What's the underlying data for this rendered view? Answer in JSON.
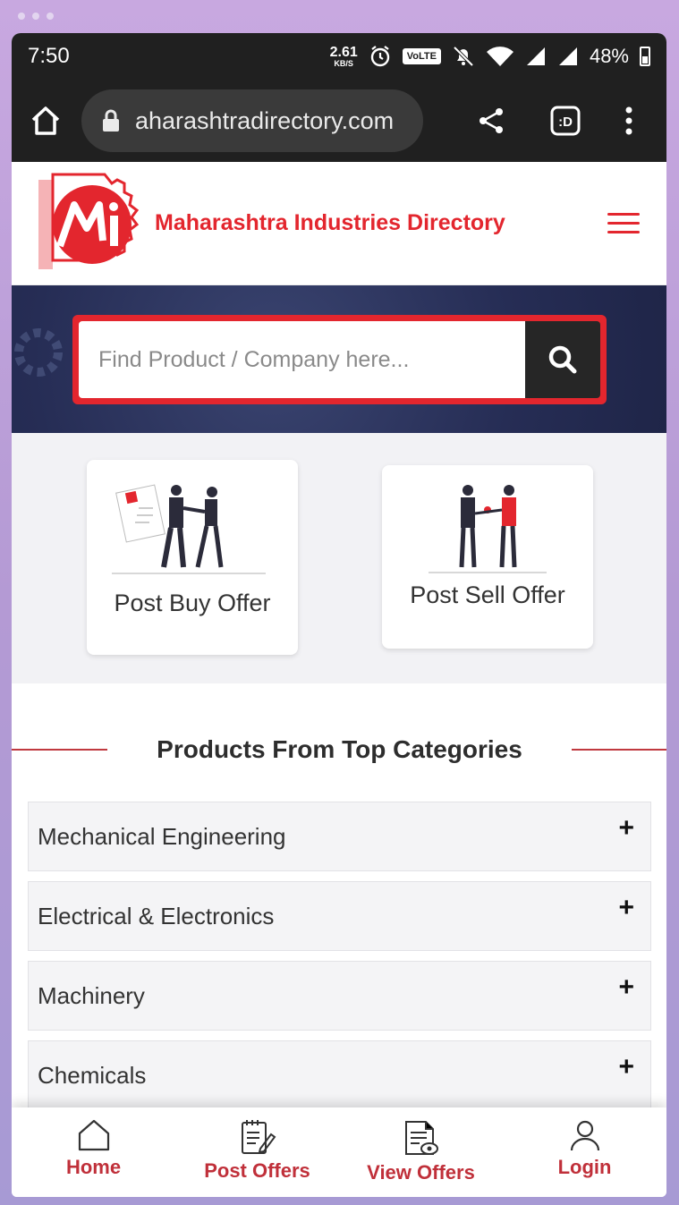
{
  "status_bar": {
    "time": "7:50",
    "net_speed_value": "2.61",
    "net_speed_unit": "KB/S",
    "volte": "VoLTE",
    "battery": "48%"
  },
  "browser": {
    "url": "aharashtradirectory.com"
  },
  "header": {
    "site_name": "Maharashtra Industries Directory"
  },
  "search": {
    "placeholder": "Find Product / Company here..."
  },
  "offers": {
    "buy_label": "Post Buy Offer",
    "sell_label": "Post Sell Offer"
  },
  "categories": {
    "title": "Products From Top Categories",
    "items": [
      {
        "label": "Mechanical Engineering",
        "toggle": "+"
      },
      {
        "label": "Electrical & Electronics",
        "toggle": "+"
      },
      {
        "label": "Machinery",
        "toggle": "+"
      },
      {
        "label": "Chemicals",
        "toggle": "+"
      }
    ]
  },
  "bottom_nav": {
    "items": [
      {
        "label": "Home",
        "icon": "home-icon"
      },
      {
        "label": "Post Offers",
        "icon": "post-offer-icon"
      },
      {
        "label": "View Offers",
        "icon": "view-offer-icon"
      },
      {
        "label": "Login",
        "icon": "user-icon"
      }
    ]
  },
  "colors": {
    "brand_red": "#e3262e",
    "nav_red": "#c0303a",
    "dark": "#202020"
  }
}
